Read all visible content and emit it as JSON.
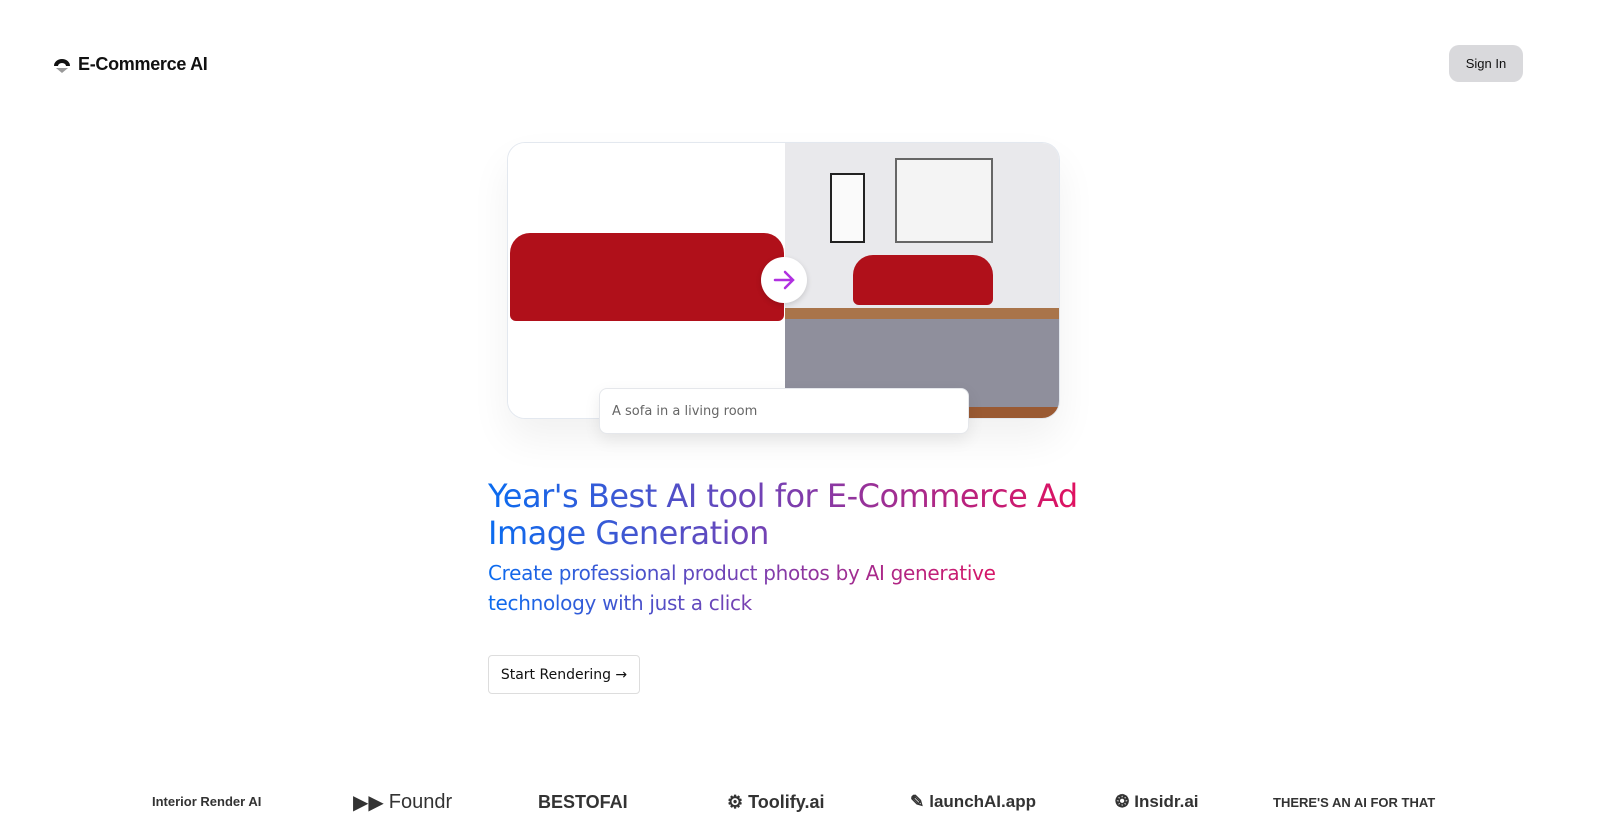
{
  "header": {
    "brand": "E-Commerce AI",
    "brand_icon": "logo-icon",
    "sign_in": "Sign In"
  },
  "hero": {
    "prompt_text": "A sofa in a living room",
    "arrow_icon": "arrow-right-icon"
  },
  "headline": {
    "title": "Year's Best AI tool for E-Commerce Ad Image Generation",
    "subtitle": "Create professional product photos by AI generative technology with just a click",
    "cta": "Start Rendering →"
  },
  "colors": {
    "gradient_start": "#0a6cf0",
    "gradient_end": "#e0115f"
  },
  "partners": [
    "Interior Render AI",
    "Foundr",
    "BESTOFAI",
    "Toolify.ai",
    "launchAI.app",
    "Insidr.ai",
    "THERE'S AN AI FOR THAT"
  ]
}
